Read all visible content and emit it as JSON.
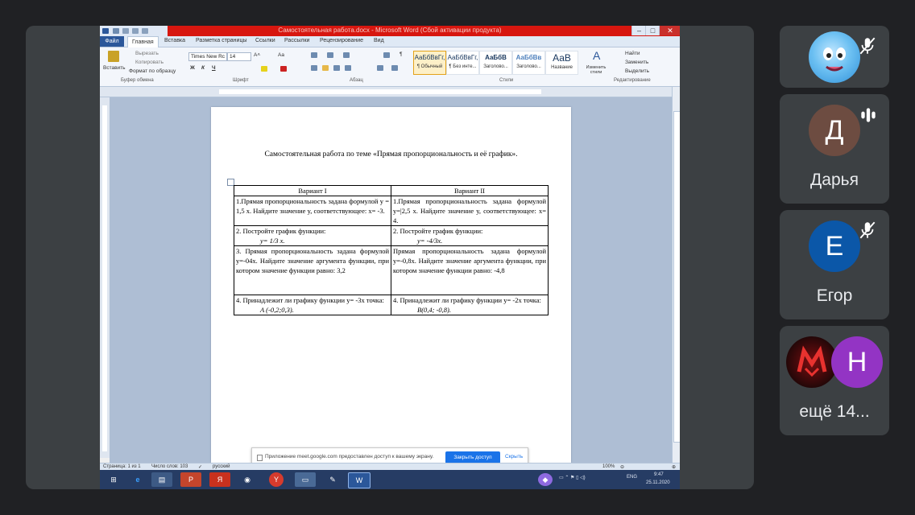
{
  "word": {
    "title": "Самостоятельная работа.docx - Microsoft Word (Сбой активации продукта)",
    "window_buttons": [
      "–",
      "□",
      "✕"
    ],
    "tabs": [
      "Файл",
      "Главная",
      "Вставка",
      "Разметка страницы",
      "Ссылки",
      "Рассылки",
      "Рецензирование",
      "Вид"
    ],
    "clipboard": {
      "paste": "Вставить",
      "cut": "Вырезать",
      "copy": "Копировать",
      "format_painter": "Формат по образцу",
      "group": "Буфер обмена"
    },
    "font": {
      "name": "Times New Rc",
      "size": "14",
      "group": "Шрифт",
      "bold": "Ж",
      "italic": "К",
      "underline": "Ч",
      "change_case": "Aa"
    },
    "paragraph_group": "Абзац",
    "styles": [
      {
        "sample": "АаБбВвГг,",
        "name": "¶ Обычный"
      },
      {
        "sample": "АаБбВвГг,",
        "name": "¶ Без инте..."
      },
      {
        "sample": "АаБбВ",
        "name": "Заголово..."
      },
      {
        "sample": "АаБбВв",
        "name": "Заголово..."
      },
      {
        "sample": "АаВ",
        "name": "Название"
      }
    ],
    "change_styles": "Изменить стили",
    "styles_group": "Стили",
    "editing": {
      "find": "Найти",
      "replace": "Заменить",
      "select": "Выделить",
      "group": "Редактирование"
    },
    "document": {
      "heading": "Самостоятельная работа по теме «Прямая пропорциональность и её график».",
      "variant1": "Вариант I",
      "variant2": "Вариант II",
      "rows": [
        [
          "1.Прямая пропорциональность задана формулой y = 1,5 x. Найдите значение y, соответствующее: x= -3.",
          "1.Прямая пропорциональность задана формулой y=|2,5 x. Найдите значение y, соответствующее: x= 4."
        ],
        [
          "2. Постройте график функции:",
          "2. Постройте график функции:"
        ],
        [
          "3. Прямая пропорциональность задана формулой y=-04x. Найдите значение аргумента функции, при котором значение функции равно: 3,2",
          "Прямая пропорциональность задана формулой y=-0,8x. Найдите значение аргумента функции, при котором значение функции равно: -4,8"
        ],
        [
          "4. Принадлежит ли графику функции y= -3x точка:",
          "4. Принадлежит ли графику функции y= -2x точка:"
        ]
      ],
      "row2_formula": [
        "y= 1/3 x.",
        "y= -4/3x."
      ],
      "row4_points": [
        "A (-0,2;0,3).",
        "B(0,4; -0,8)."
      ]
    },
    "status": {
      "page": "Страница: 1 из 1",
      "words": "Число слов: 103",
      "lang": "русский",
      "zoom": "100%"
    },
    "notification": {
      "message": "Приложение meet.google.com предоставлен доступ к вашему экрану.",
      "close_access": "Закрыть доступ",
      "hide": "Скрыть"
    },
    "tray": {
      "lang": "ENG",
      "time": "9:47",
      "date": "25.11.2020"
    }
  },
  "participants": [
    {
      "name": "",
      "initial": "",
      "muted": true,
      "color": "#3aa0e8"
    },
    {
      "name": "Дарья",
      "initial": "Д",
      "muted": false,
      "color": "#6d4c41"
    },
    {
      "name": "Егор",
      "initial": "Е",
      "muted": true,
      "color": "#0b57a8"
    },
    {
      "name": "ещё 14...",
      "initial": "Н",
      "muted": false,
      "color": "#9334c4"
    }
  ]
}
